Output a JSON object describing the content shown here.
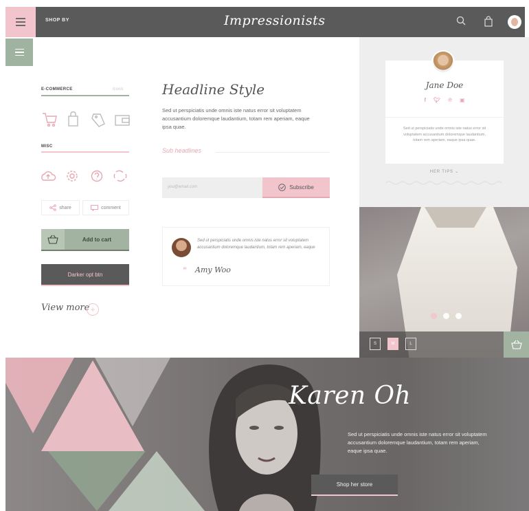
{
  "header": {
    "shop_by": "SHOP BY",
    "logo": "Impressionists",
    "icons": [
      "hamburger-icon",
      "search-icon",
      "bag-icon",
      "avatar"
    ]
  },
  "left": {
    "ecommerce_label": "E-COMMERCE",
    "ecommerce_right": "Iconis",
    "ecommerce_icons": [
      "cart-icon",
      "bag-icon",
      "tag-icon",
      "wallet-icon"
    ],
    "misc_label": "MISC",
    "misc_icons": [
      "cloud-upload-icon",
      "settings-icon",
      "help-icon",
      "refresh-icon"
    ],
    "share_label": "share",
    "comment_label": "comment",
    "add_to_cart": "Add to cart",
    "darker_btn": "Darker opt btn",
    "view_more": "View more"
  },
  "middle": {
    "headline": "Headline Style",
    "body": "Sed ut perspiciatis unde omnis iste natus error sit voluptatem accusantium doloremque laudantium, totam rem aperiam, eaque ipsa quae.",
    "subheadline": "Sub headlines",
    "email_placeholder": "you@email.com",
    "subscribe": "Subscribe",
    "quote_text": "Sed ut perspiciatis unde omnis iste natus error sit voluptatem accusantium doloremque laudantium, totam rem aperiam, eaque",
    "quote_author": "Amy Woo"
  },
  "right": {
    "profile_name": "Jane Doe",
    "socials": [
      "f",
      "t",
      "p",
      "i"
    ],
    "bio": "Sed ut perspiciatis unde omnis iste natus error sit voluptatem accusantium doloremque laudantium, totam rem aperiam, eaque ipsa quae.",
    "her_tips": "HER TIPS",
    "sizes": [
      "S",
      "M",
      "L"
    ],
    "active_size": "M"
  },
  "banner": {
    "name": "Karen Oh",
    "text": "Sed ut perspiciatis unde omnis iste natus error sit voluptatem accusantium doloremque laudantium, totam rem aperiam, eaque ipsa quae.",
    "shop_btn": "Shop her store"
  },
  "colors": {
    "pink": "#f2c5cc",
    "sage": "#a3b3a1",
    "charcoal": "#5b5a5a"
  }
}
